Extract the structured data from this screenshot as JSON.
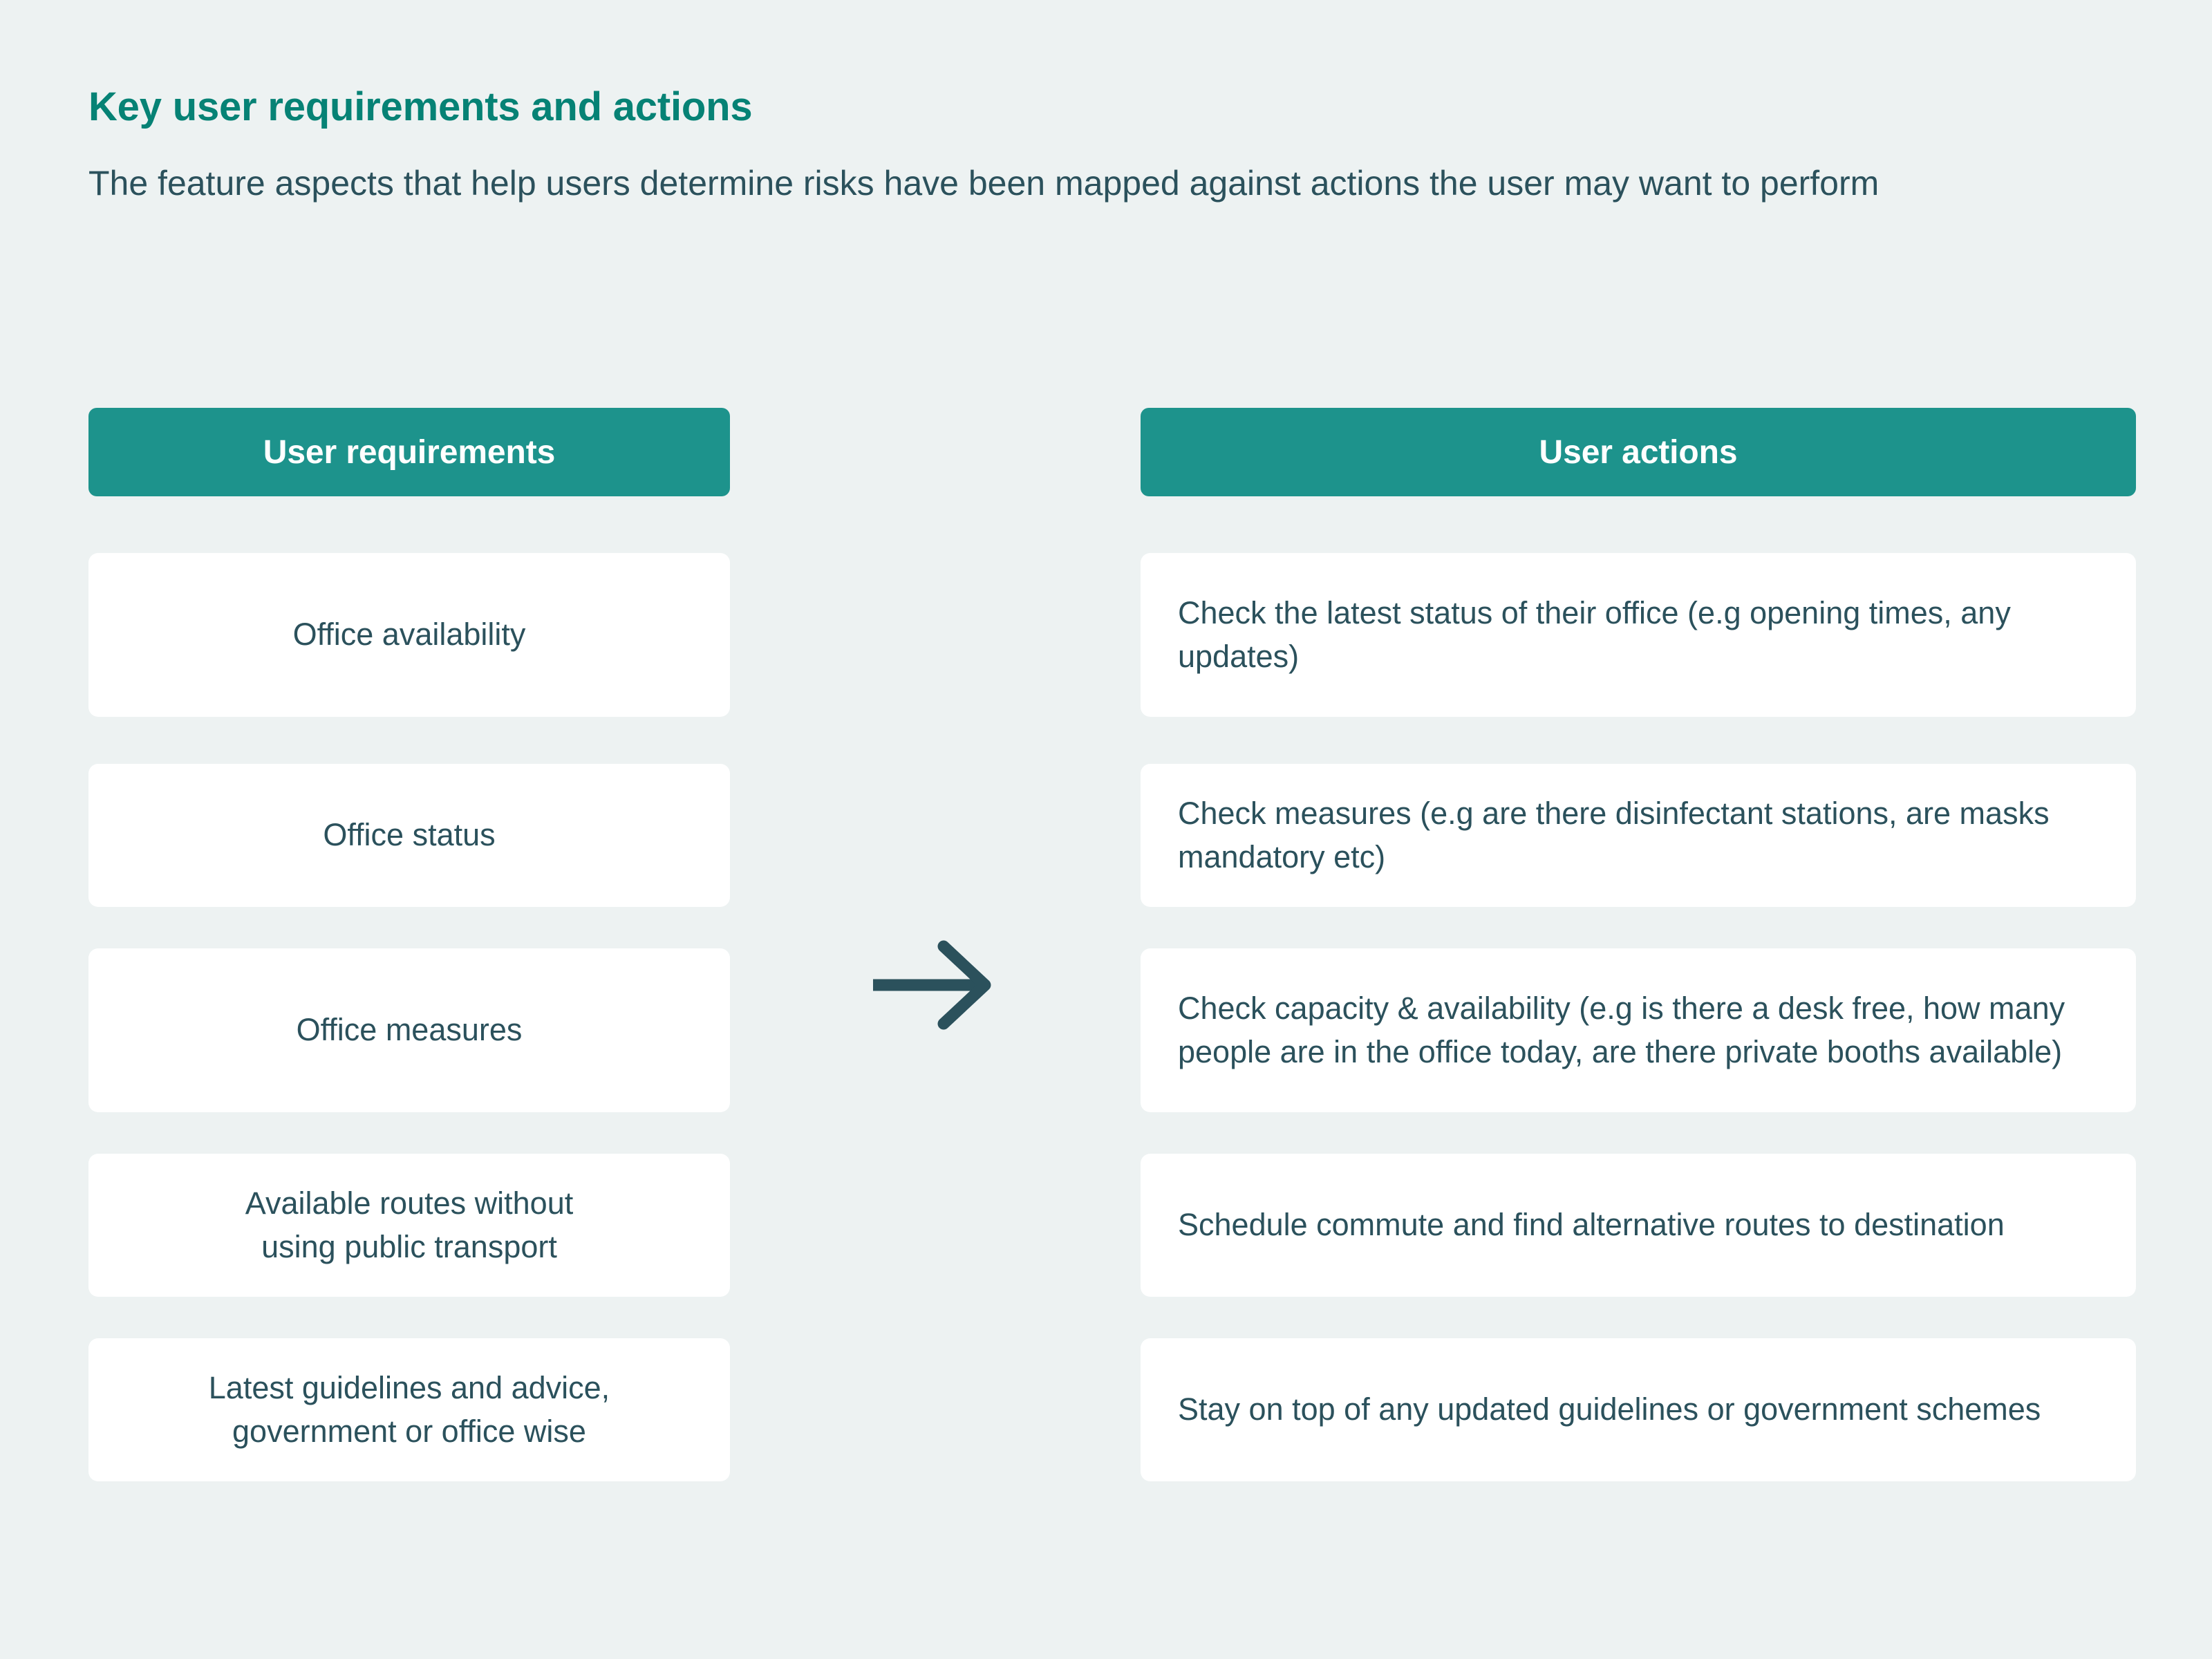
{
  "heading": {
    "title": "Key user requirements and actions",
    "subtitle": "The feature aspects that help users determine risks have been mapped against actions the user may want to perform"
  },
  "colors": {
    "background": "#edf2f2",
    "accent_teal": "#1d938c",
    "title_teal": "#068275",
    "body_text": "#2b515c",
    "card_background": "#ffffff"
  },
  "columns": {
    "requirements": {
      "header": "User requirements",
      "items": [
        {
          "text": "Office availability"
        },
        {
          "text": "Office status"
        },
        {
          "text": "Office measures"
        },
        {
          "text": "Available routes without\nusing public transport"
        },
        {
          "text": "Latest guidelines and advice,\ngovernment or office wise"
        }
      ]
    },
    "actions": {
      "header": "User actions",
      "items": [
        {
          "text": "Check the latest status of their office (e.g opening times, any updates)"
        },
        {
          "text": "Check measures (e.g are there disinfectant stations, are masks mandatory etc)"
        },
        {
          "text": "Check capacity & availability (e.g is there a desk free, how many people are in the office today, are there private booths available)"
        },
        {
          "text": "Schedule commute and find alternative routes to destination"
        },
        {
          "text": "Stay on top of any updated guidelines or government schemes"
        }
      ]
    }
  },
  "connector": {
    "icon": "arrow-right-icon",
    "color": "#2b515c"
  }
}
